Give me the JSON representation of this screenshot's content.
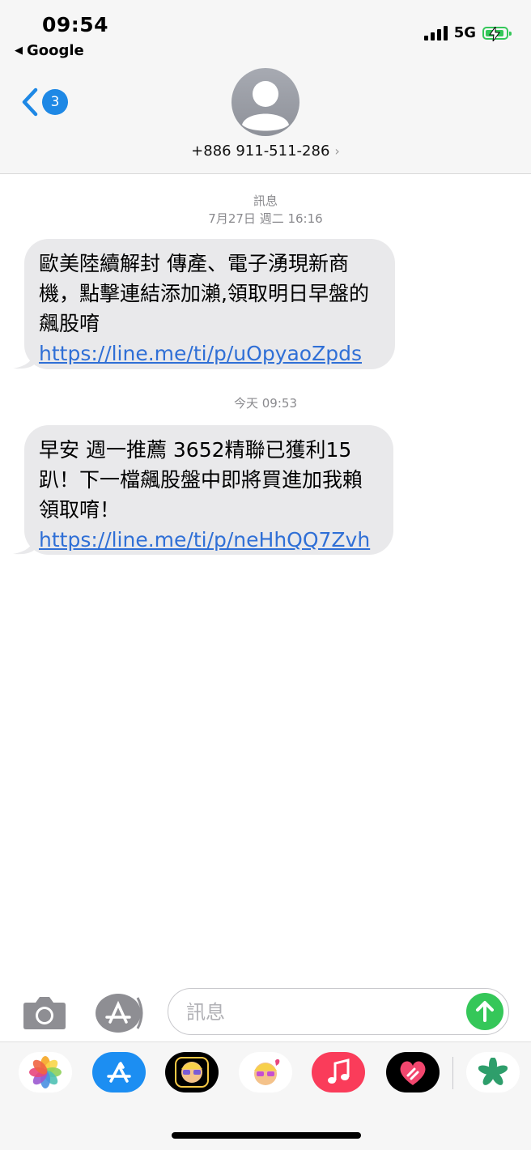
{
  "status_bar": {
    "time": "09:54",
    "back_app": "Google",
    "network": "5G",
    "signal_bars": 4,
    "battery_charging": true
  },
  "conversation": {
    "unread_count": "3",
    "contact_number": "+886 911-511-286",
    "chevron": "›"
  },
  "messages": [
    {
      "header_label": "訊息",
      "timestamp": "7月27日 週二 16:16",
      "text": "歐美陸續解封 傳產、電子湧現新商機，點擊連結添加瀨,領取明日早盤的飆股唷 ",
      "link": "https://line.me/ti/p/uOpyaoZpds"
    },
    {
      "timestamp": "今天 09:53",
      "text": "早安 週一推薦 3652精聯已獲利15趴！下一檔飆股盤中即將買進加我賴領取唷！",
      "link": "https://line.me/ti/p/neHhQQ7Zvh"
    }
  ],
  "compose": {
    "placeholder": "訊息"
  },
  "app_drawer": [
    {
      "icon": "photos-icon"
    },
    {
      "icon": "app-store-icon"
    },
    {
      "icon": "memoji-icon"
    },
    {
      "icon": "memoji-stickers-icon"
    },
    {
      "icon": "music-icon"
    },
    {
      "icon": "digital-touch-icon"
    },
    {
      "icon": "clover-app-icon"
    }
  ],
  "colors": {
    "accent": "#1e88e5",
    "link": "#2f6fd6",
    "bubble": "#e9e9eb",
    "send": "#35c759"
  }
}
